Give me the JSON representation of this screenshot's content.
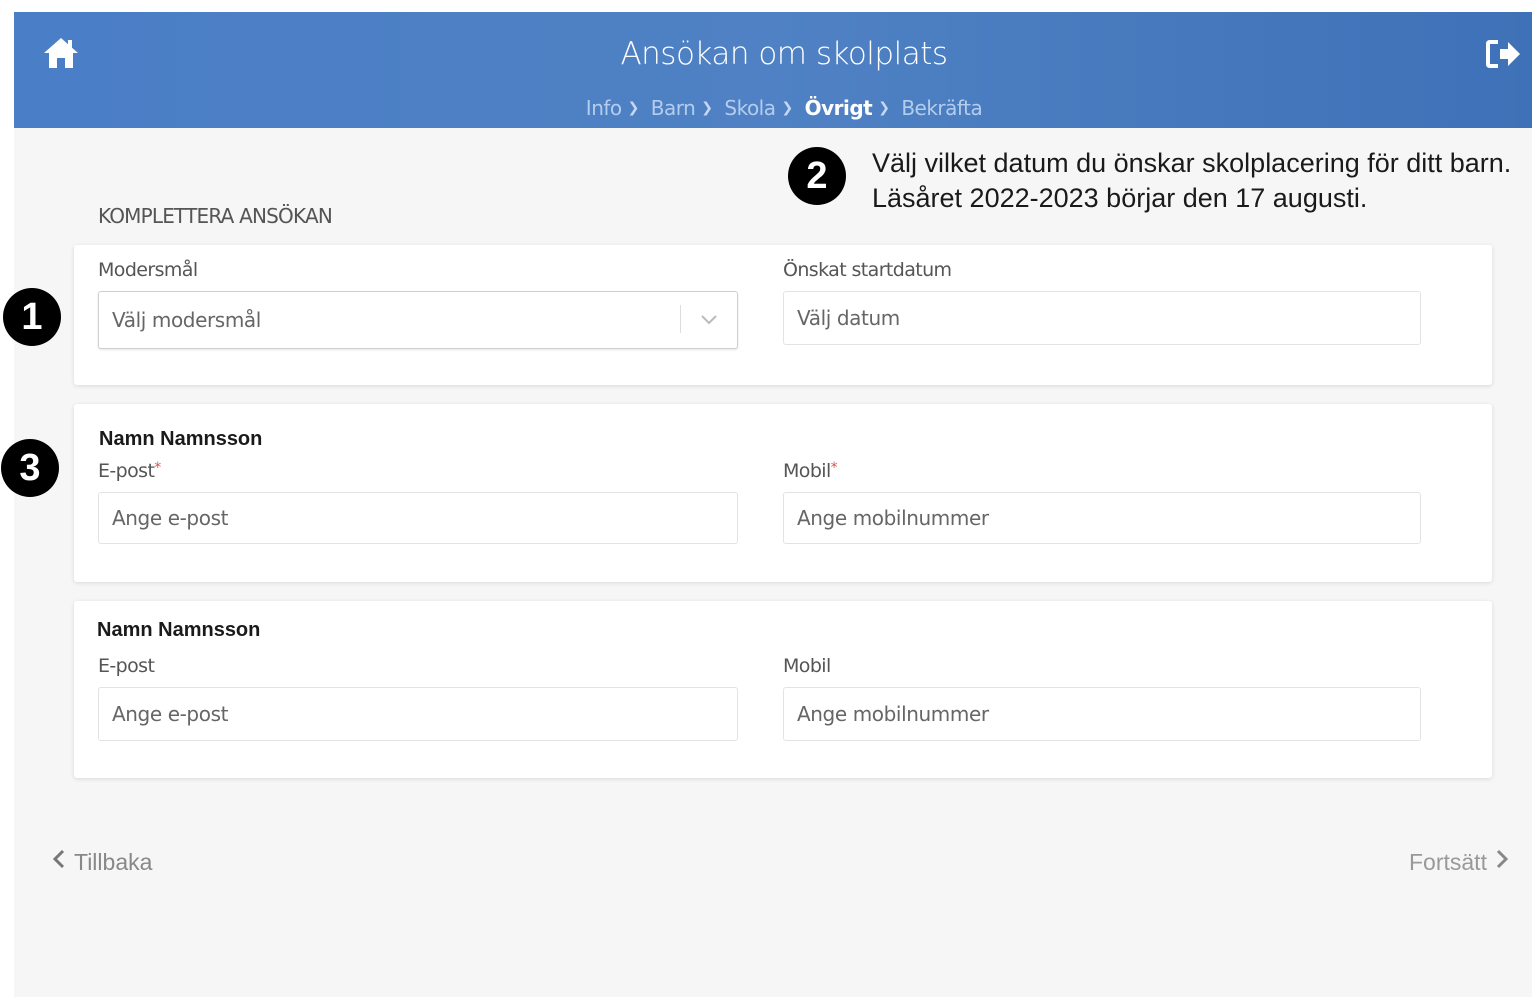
{
  "header": {
    "title": "Ansökan om skolplats",
    "home_icon": "home-icon",
    "logout_icon": "logout-icon",
    "breadcrumb": [
      {
        "label": "Info"
      },
      {
        "label": "Barn"
      },
      {
        "label": "Skola"
      },
      {
        "label": "Övrigt",
        "active": true
      },
      {
        "label": "Bekräfta"
      }
    ]
  },
  "section": {
    "heading": "KOMPLETTERA ANSÖKAN"
  },
  "card1": {
    "language_label": "Modersmål",
    "language_placeholder": "Välj modersmål",
    "date_label": "Önskat startdatum",
    "date_placeholder": "Välj datum"
  },
  "guardian1": {
    "name": "Namn Namnsson",
    "email_label": "E-post",
    "email_required": "*",
    "email_placeholder": "Ange e-post",
    "mobile_label": "Mobil",
    "mobile_required": "*",
    "mobile_placeholder": "Ange mobilnummer"
  },
  "guardian2": {
    "name": "Namn Namnsson",
    "email_label": "E-post",
    "email_placeholder": "Ange e-post",
    "mobile_label": "Mobil",
    "mobile_placeholder": "Ange mobilnummer"
  },
  "nav": {
    "back": "Tillbaka",
    "next": "Fortsätt"
  },
  "annotations": {
    "badge1": "1",
    "badge2": "2",
    "badge3": "3",
    "note": "Välj vilket datum du önskar skolplacering för ditt barn. Läsåret 2022-2023 börjar den 17 augusti."
  },
  "colors": {
    "header": "#4a7ec6",
    "required": "#d9534f"
  }
}
